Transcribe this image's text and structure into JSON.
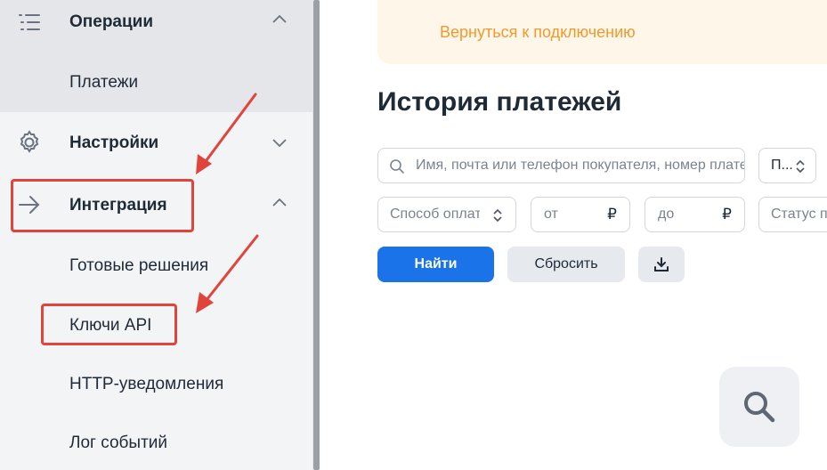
{
  "sidebar": {
    "items": [
      {
        "label": "Операции"
      },
      {
        "label": "Платежи"
      },
      {
        "label": "Настройки"
      },
      {
        "label": "Интеграция"
      },
      {
        "label": "Готовые решения"
      },
      {
        "label": "Ключи API"
      },
      {
        "label": "HTTP-уведомления"
      },
      {
        "label": "Лог событий"
      }
    ]
  },
  "main": {
    "banner_link": "Вернуться к подключению",
    "title": "История платежей",
    "filters": {
      "search_placeholder": "Имя, почта или телефон покупателя, номер платежа",
      "sort_value": "П...",
      "method_placeholder": "Способ оплаты",
      "from_placeholder": "от",
      "to_placeholder": "до",
      "currency_symbol": "₽",
      "status_placeholder": "Статус платежа"
    },
    "buttons": {
      "find": "Найти",
      "reset": "Сбросить"
    }
  },
  "colors": {
    "accent": "#1a73e8",
    "annotation": "#e0443a",
    "banner_text": "#f09a2c"
  }
}
